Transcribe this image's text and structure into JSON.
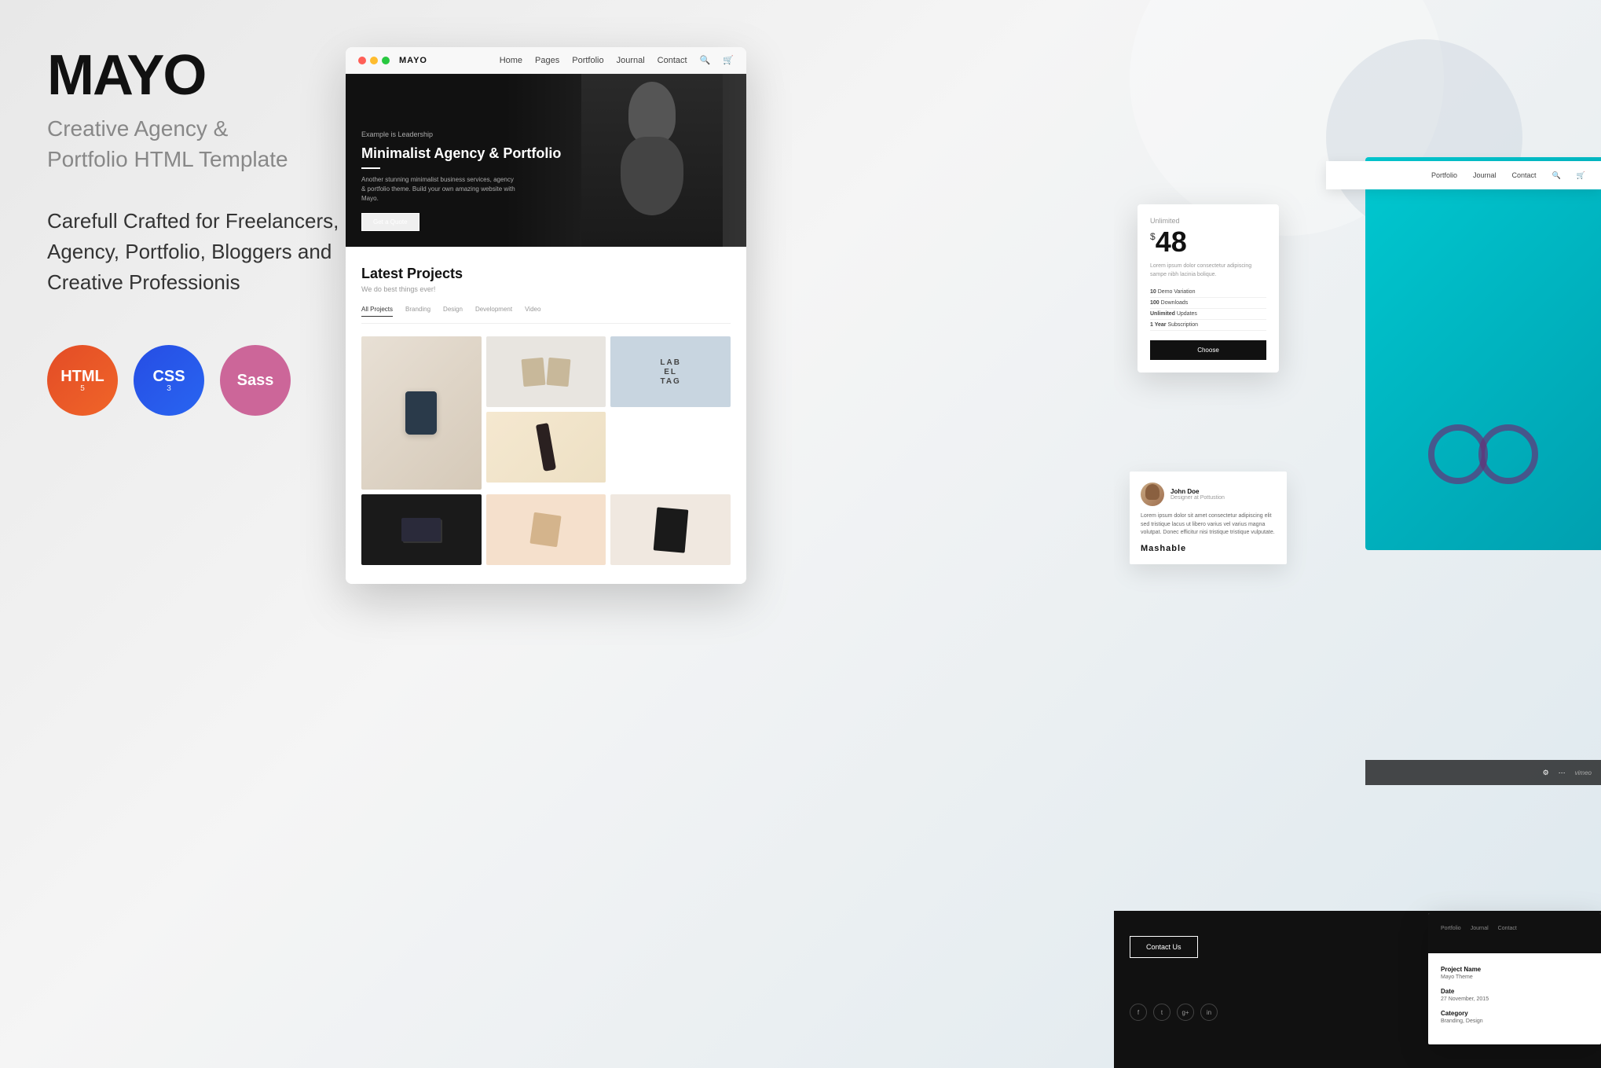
{
  "brand": {
    "name": "MAYO",
    "subtitle": "Creative Agency &\nPortfolio HTML Template",
    "description": "Carefull Crafted for Freelancers,\nAgency, Portfolio, Bloggers and\nCreative Professionis"
  },
  "tech_icons": [
    {
      "label": "HTML",
      "sub": "5",
      "type": "html"
    },
    {
      "label": "CSS",
      "sub": "3",
      "type": "css"
    },
    {
      "label": "Sass",
      "sub": "",
      "type": "sass"
    }
  ],
  "browser": {
    "logo": "MAYO",
    "nav_items": [
      "Home",
      "Pages",
      "Portfolio",
      "Journal",
      "Contact"
    ]
  },
  "hero": {
    "tag": "Example is Leadership",
    "title": "Minimalist Agency & Portfolio",
    "description": "Another stunning minimalist business services, agency & portfolio theme. Build your own amazing website with Mayo.",
    "button": "Get a Quote"
  },
  "projects_section": {
    "title": "Latest Projects",
    "subtitle": "We do best things ever!",
    "filter_tabs": [
      "All Projects",
      "Branding",
      "Design",
      "Development",
      "Video"
    ]
  },
  "pricing": {
    "plan": "Unlimited",
    "currency": "$",
    "amount": "48",
    "description": "Lorem ipsum dolor consectetur adipiscing sampe nibh lacinia bolique.",
    "features": [
      {
        "count": "10",
        "label": "Demo Variation"
      },
      {
        "count": "100",
        "label": "Downloads"
      },
      {
        "count": "Unlimited",
        "label": "Updates"
      },
      {
        "count": "1 Year",
        "label": "Subscription"
      }
    ],
    "button": "Choose"
  },
  "top_nav": {
    "items": [
      "Portfolio",
      "Journal",
      "Contact"
    ]
  },
  "testimonial": {
    "author_name": "John Doe",
    "author_role": "Designer at Pottustion",
    "text": "Lorem ipsum dolor sit amet consectetur adipiscing elit sed tristique lacus ut libero varius vel varius magna volutpat. Donec efficitur nisi tristique tristique vulputate.",
    "brand": "Mashable"
  },
  "project_detail": {
    "nav_items": [
      "Portfolio",
      "Journal",
      "Contact"
    ],
    "fields": [
      {
        "label": "Project Name",
        "value": "Mayo Theme"
      },
      {
        "label": "Date",
        "value": "27 November, 2015"
      },
      {
        "label": "Category",
        "value": "Branding, Design"
      }
    ]
  },
  "dark_section": {
    "contact_button": "Contact Us",
    "social_icons": [
      "f",
      "t",
      "g+",
      "in"
    ]
  },
  "vimeo_bar": {
    "icons": [
      "⚙",
      "✦",
      "vimeo"
    ]
  }
}
